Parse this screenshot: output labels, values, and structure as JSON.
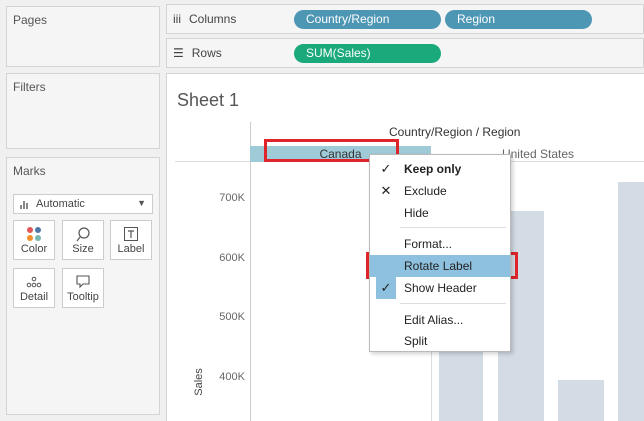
{
  "sidebar": {
    "pages_title": "Pages",
    "filters_title": "Filters",
    "marks_title": "Marks",
    "mark_type": "Automatic",
    "mark_buttons": [
      {
        "label": "Color",
        "icon": "color-dots-icon"
      },
      {
        "label": "Size",
        "icon": "size-lasso-icon"
      },
      {
        "label": "Label",
        "icon": "text-T-icon"
      },
      {
        "label": "Detail",
        "icon": "detail-dots-icon"
      },
      {
        "label": "Tooltip",
        "icon": "speech-bubble-icon"
      }
    ]
  },
  "shelves": {
    "columns_label": "Columns",
    "rows_label": "Rows",
    "columns_pills": [
      "Country/Region",
      "Region"
    ],
    "rows_pills": [
      "SUM(Sales)"
    ],
    "colors": {
      "dimension": "#4d96b4",
      "measure": "#19a97a"
    }
  },
  "viz": {
    "sheet_title": "Sheet 1",
    "header_title": "Country/Region / Region",
    "column_headers": [
      "Canada",
      "United States"
    ],
    "y_axis_label": "Sales",
    "y_ticks": [
      "700K",
      "600K",
      "500K",
      "400K"
    ],
    "bar_color": "#d3dbe4"
  },
  "context_menu": {
    "items": [
      {
        "label": "Keep only",
        "mark": "check",
        "bold": true
      },
      {
        "label": "Exclude",
        "mark": "x"
      },
      {
        "label": "Hide",
        "mark": ""
      },
      {
        "label": "Format...",
        "mark": ""
      },
      {
        "label": "Rotate Label",
        "mark": "",
        "selected": true
      },
      {
        "label": "Show Header",
        "mark": "check"
      },
      {
        "label": "Edit Alias...",
        "mark": ""
      },
      {
        "label": "Split",
        "mark": ""
      }
    ]
  },
  "highlight_color": "#e0242b"
}
